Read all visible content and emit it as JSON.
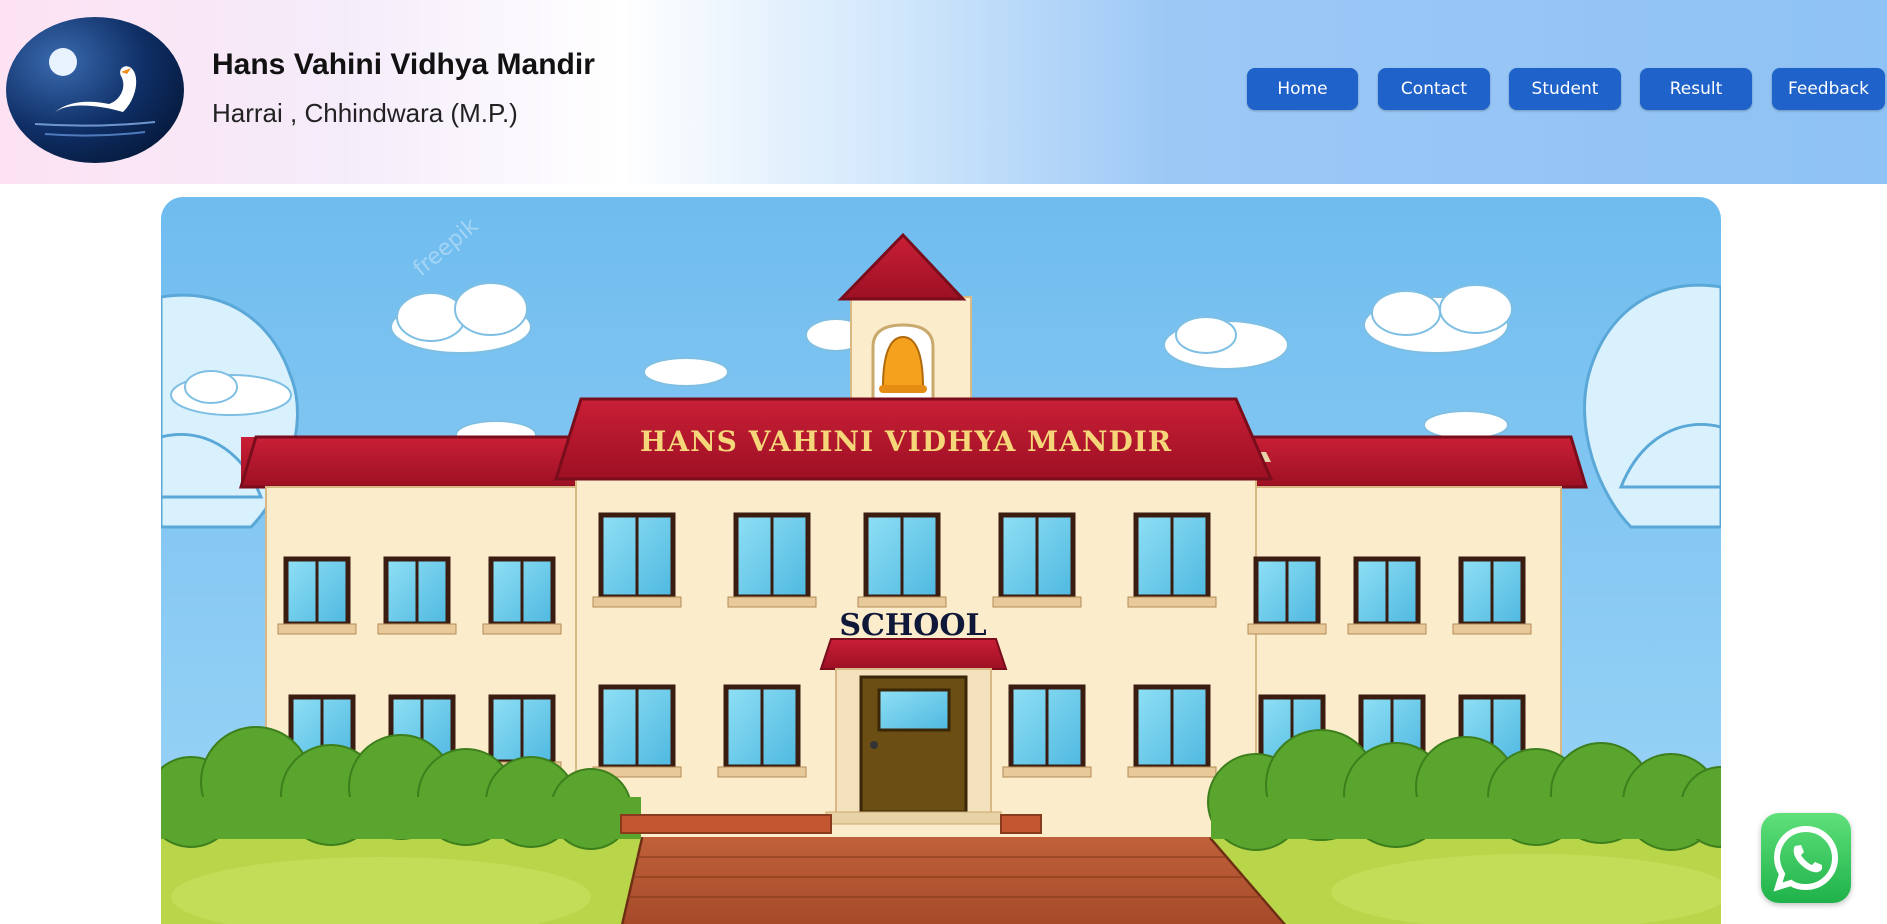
{
  "header": {
    "title": "Hans Vahini Vidhya Mandir",
    "subtitle": "Harrai , Chhindwara (M.P.)",
    "logo_icon": "swan-logo-icon"
  },
  "nav": {
    "items": [
      {
        "label": "Home"
      },
      {
        "label": "Contact"
      },
      {
        "label": "Student"
      },
      {
        "label": "Result"
      },
      {
        "label": "Feedback"
      }
    ],
    "button_color": "#1f62c9"
  },
  "hero": {
    "roof_sign": "HANS VAHINI VIDHYA MANDIR",
    "building_sign": "SCHOOL",
    "watermark": "freepik"
  },
  "whatsapp": {
    "icon": "whatsapp-icon",
    "color": "#25d366"
  },
  "colors": {
    "sky": "#7cc3f0",
    "roof": "#b3172b",
    "wall": "#fbeccb",
    "bush": "#5aa52e",
    "grass": "#b9d64a"
  }
}
